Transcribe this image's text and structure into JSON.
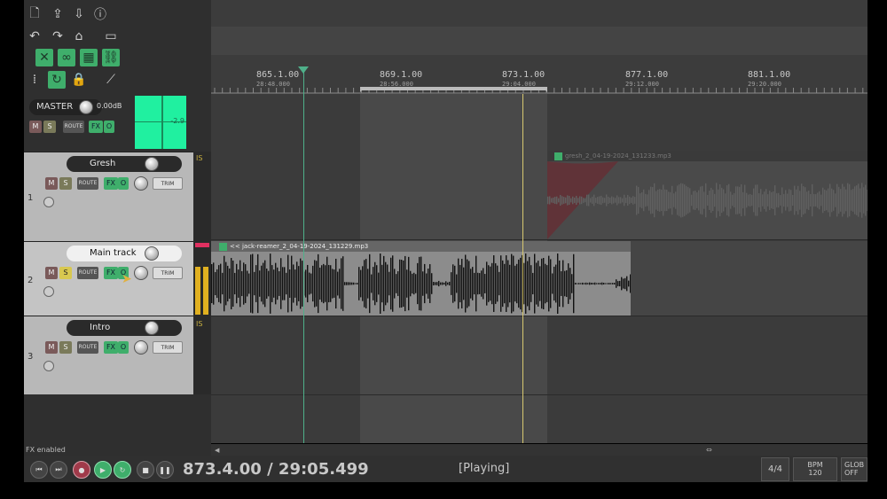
{
  "master": {
    "label": "MASTER",
    "volume": "0.00dB",
    "peak": "-2.9",
    "mute": "M",
    "solo": "S",
    "route": "ROUTE",
    "fx": "FX"
  },
  "ruler": {
    "marks": [
      {
        "bar": "865.1.00",
        "time": "28:48.000"
      },
      {
        "bar": "869.1.00",
        "time": "28:56.000"
      },
      {
        "bar": "873.1.00",
        "time": "29:04.000"
      },
      {
        "bar": "877.1.00",
        "time": "29:12.000"
      },
      {
        "bar": "881.1.00",
        "time": "29:20.000"
      }
    ]
  },
  "tracks": [
    {
      "number": "1",
      "name": "Gresh",
      "mute": "M",
      "solo": "S",
      "route": "ROUTE",
      "fx": "FX",
      "trim": "TRIM",
      "meter_label": "IS"
    },
    {
      "number": "2",
      "name": "Main track",
      "mute": "M",
      "solo": "S",
      "route": "ROUTE",
      "fx": "FX",
      "trim": "TRIM"
    },
    {
      "number": "3",
      "name": "Intro",
      "mute": "M",
      "solo": "S",
      "route": "ROUTE",
      "fx": "FX",
      "trim": "TRIM",
      "meter_label": "IS"
    }
  ],
  "items": {
    "gresh": "gresh_2_04-19-2024_131233.mp3",
    "main": "<< jack-reamer_2_04-19-2024_131229.mp3"
  },
  "status": {
    "fx_enabled": "FX enabled"
  },
  "transport": {
    "position": "873.4.00 / 29:05.499",
    "state": "[Playing]",
    "time_sig": "4/4",
    "bpm_label": "BPM",
    "bpm_value": "120",
    "global_label": "GLOB",
    "global_value": "OFF"
  },
  "colors": {
    "accent_green": "#3fae6b",
    "meter_green": "#20f0a0",
    "play_cursor": "#d8c870",
    "edit_cursor": "#4fb08a"
  }
}
